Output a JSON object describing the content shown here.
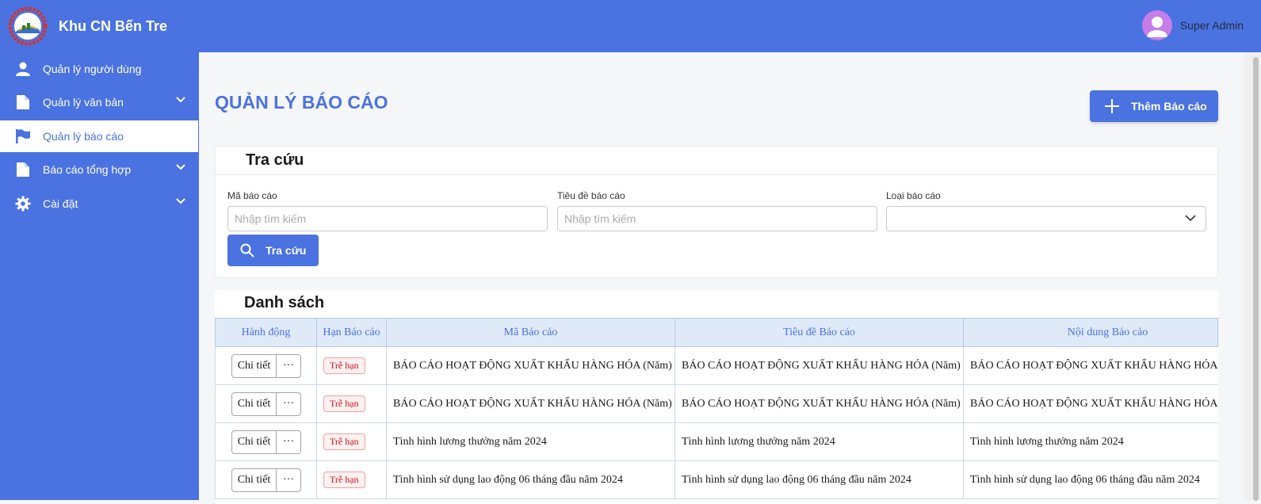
{
  "sidebar": {
    "brand_title": "Khu CN Bến Tre",
    "items": [
      {
        "label": "Quản lý người dùng",
        "icon": "user-icon",
        "has_chevron": false,
        "active": false
      },
      {
        "label": "Quản lý văn bản",
        "icon": "document-icon",
        "has_chevron": true,
        "active": false
      },
      {
        "label": "Quản lý báo cáo",
        "icon": "flag-icon",
        "has_chevron": false,
        "active": true
      },
      {
        "label": "Báo cáo tổng hợp",
        "icon": "document-icon",
        "has_chevron": true,
        "active": false
      },
      {
        "label": "Cài đặt",
        "icon": "gear-icon",
        "has_chevron": true,
        "active": false
      }
    ]
  },
  "header": {
    "user_name": "Super Admin"
  },
  "main": {
    "page_title": "QUẢN LÝ BÁO CÁO",
    "add_button_label": "Thêm Báo cáo",
    "search": {
      "title": "Tra cứu",
      "fields": [
        {
          "label": "Mã báo cáo",
          "placeholder": "Nhập tìm kiếm"
        },
        {
          "label": "Tiêu đề báo cáo",
          "placeholder": "Nhập tìm kiếm"
        },
        {
          "label": "Loại báo cáo",
          "placeholder": ""
        }
      ],
      "button_label": "Tra cứu"
    },
    "list": {
      "title": "Danh sách",
      "columns": [
        "Hành động",
        "Hạn Báo cáo",
        "Mã Báo cáo",
        "Tiêu đề Báo cáo",
        "Nội dung Báo cáo"
      ],
      "rows": [
        {
          "action": "Chi tiết",
          "more": "···",
          "deadline": "Trễ hạn",
          "code": "BÁO CÁO HOẠT ĐỘNG XUẤT KHẨU HÀNG HÓA (Năm)",
          "title": "BÁO CÁO HOẠT ĐỘNG XUẤT KHẨU HÀNG HÓA (Năm)",
          "content": "BÁO CÁO HOẠT ĐỘNG XUẤT KHẨU HÀNG HÓA (Năm)"
        },
        {
          "action": "Chi tiết",
          "more": "···",
          "deadline": "Trễ hạn",
          "code": "BÁO CÁO HOẠT ĐỘNG XUẤT KHẨU HÀNG HÓA (Năm)",
          "title": "BÁO CÁO HOẠT ĐỘNG XUẤT KHẨU HÀNG HÓA (Năm)",
          "content": "BÁO CÁO HOẠT ĐỘNG XUẤT KHẨU HÀNG HÓA (Năm)"
        },
        {
          "action": "Chi tiết",
          "more": "···",
          "deadline": "Trễ hạn",
          "code": "Tình hình lương thưởng năm 2024",
          "title": "Tình hình lương thưởng năm 2024",
          "content": "Tình hình lương thưởng năm 2024"
        },
        {
          "action": "Chi tiết",
          "more": "···",
          "deadline": "Trễ hạn",
          "code": "Tình hình sử dụng lao động 06 tháng đầu năm 2024",
          "title": "Tình hình sử dụng lao động 06 tháng đầu năm 2024",
          "content": "Tình hình sử dụng lao động 06 tháng đầu năm 2024"
        }
      ]
    }
  },
  "colors": {
    "primary": "#4a72e0",
    "late_badge": "#cf1322",
    "avatar": "#c77de8"
  }
}
